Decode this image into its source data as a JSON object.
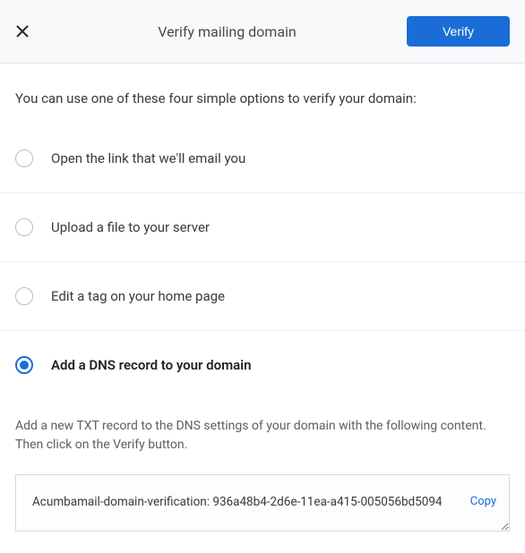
{
  "header": {
    "title": "Verify mailing domain",
    "verify_label": "Verify"
  },
  "intro": "You can use one of these four simple options to verify your domain:",
  "options": [
    {
      "label": "Open the link that we'll email you"
    },
    {
      "label": "Upload a file to your server"
    },
    {
      "label": "Edit a tag on your home page"
    },
    {
      "label": "Add a DNS record to your domain"
    }
  ],
  "dns": {
    "description": "Add a new TXT record to the DNS settings of your domain with the following content. Then click on the Verify button.",
    "txt_value": "Acumbamail-domain-verification: 936a48b4-2d6e-11ea-a415-005056bd5094",
    "copy_label": "Copy"
  }
}
